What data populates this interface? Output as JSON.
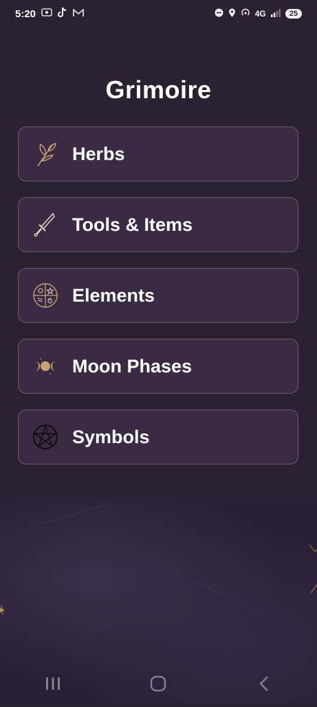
{
  "status_bar": {
    "time": "5:20",
    "network": "4G",
    "battery": "25"
  },
  "app": {
    "title": "Grimoire"
  },
  "menu": {
    "items": [
      {
        "label": "Herbs",
        "icon": "herb-leaf-icon"
      },
      {
        "label": "Tools & Items",
        "icon": "dagger-icon"
      },
      {
        "label": "Elements",
        "icon": "elements-circle-icon"
      },
      {
        "label": "Moon Phases",
        "icon": "moon-phases-icon"
      },
      {
        "label": "Symbols",
        "icon": "pentacle-icon"
      }
    ]
  },
  "colors": {
    "background": "#2b2130",
    "card": "#3a2a42",
    "card_border": "#6b5a74",
    "icon_gold": "#c9a27a"
  },
  "nav": {
    "buttons": [
      "recent-apps-icon",
      "home-icon",
      "back-icon"
    ]
  }
}
